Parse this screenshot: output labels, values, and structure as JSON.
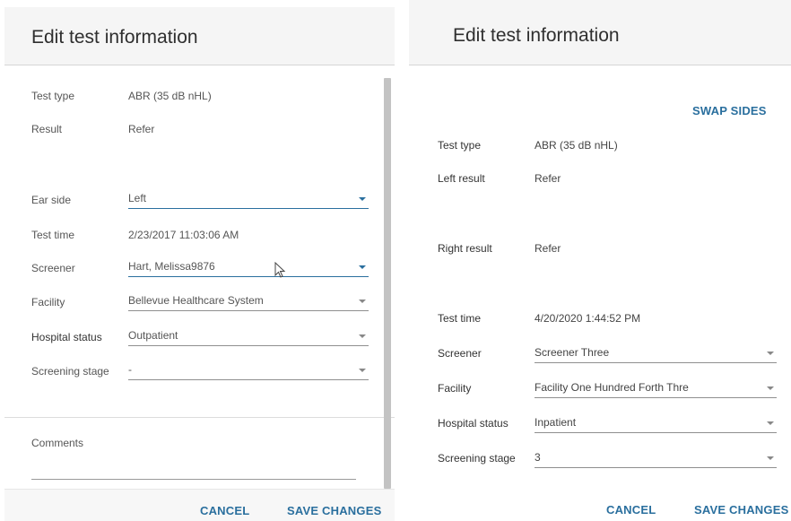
{
  "dialog_left": {
    "title": "Edit test information",
    "test_type": {
      "label": "Test type",
      "value": "ABR (35 dB nHL)"
    },
    "result": {
      "label": "Result",
      "value": "Refer"
    },
    "ear_side": {
      "label": "Ear side",
      "value": "Left"
    },
    "test_time": {
      "label": "Test time",
      "value": "2/23/2017 11:03:06 AM"
    },
    "screener": {
      "label": "Screener",
      "value": "Hart, Melissa9876"
    },
    "facility": {
      "label": "Facility",
      "value": "Bellevue Healthcare System"
    },
    "hospital_status": {
      "label": "Hospital status",
      "value": "Outpatient"
    },
    "screening_stage": {
      "label": "Screening stage",
      "value": "-"
    },
    "comments": {
      "label": "Comments"
    },
    "cancel_label": "CANCEL",
    "save_label": "SAVE CHANGES"
  },
  "dialog_right": {
    "title": "Edit test information",
    "swap_label": "SWAP SIDES",
    "test_type": {
      "label": "Test type",
      "value": "ABR (35 dB nHL)"
    },
    "left_result": {
      "label": "Left result",
      "value": "Refer"
    },
    "right_result": {
      "label": "Right result",
      "value": "Refer"
    },
    "test_time": {
      "label": "Test time",
      "value": "4/20/2020 1:44:52 PM"
    },
    "screener": {
      "label": "Screener",
      "value": "Screener Three"
    },
    "facility": {
      "label": "Facility",
      "value": "Facility One Hundred Forth Thre"
    },
    "hospital_status": {
      "label": "Hospital status",
      "value": "Inpatient"
    },
    "screening_stage": {
      "label": "Screening stage",
      "value": "3"
    },
    "cancel_label": "CANCEL",
    "save_label": "SAVE CHANGES"
  },
  "colors": {
    "accent": "#2a6f9e",
    "header_bg": "#f5f5f5",
    "scrollbar": "#c3c3c3"
  },
  "icons": [
    "dropdown-caret-icon",
    "mouse-cursor-icon"
  ]
}
